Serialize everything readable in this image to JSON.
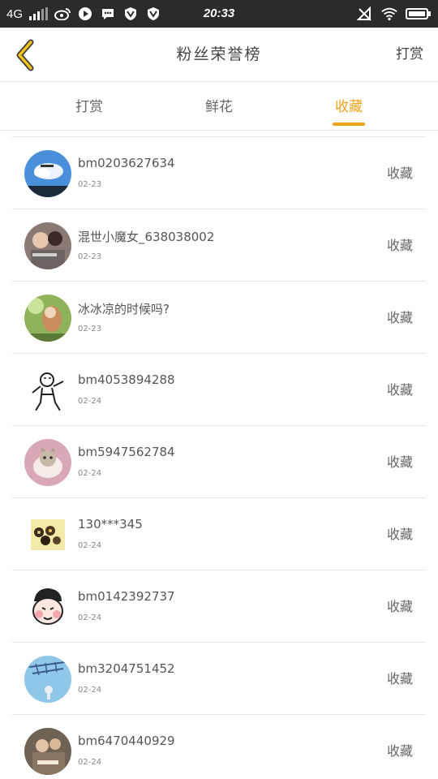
{
  "status_bar": {
    "network": "4G",
    "time": "20:33"
  },
  "header": {
    "title": "粉丝荣誉榜",
    "action_label": "打赏"
  },
  "tabs": [
    {
      "label": "打赏",
      "active": false
    },
    {
      "label": "鲜花",
      "active": false
    },
    {
      "label": "收藏",
      "active": true
    }
  ],
  "accent_color": "#f0a21b",
  "list": [
    {
      "name": "bm0203627634",
      "date": "02-23",
      "status": "收藏",
      "avatar": "sky-photo"
    },
    {
      "name": "混世小魔女_638038002",
      "date": "02-23",
      "status": "收藏",
      "avatar": "couple-photo"
    },
    {
      "name": "冰冰凉的时候吗?",
      "date": "02-23",
      "status": "收藏",
      "avatar": "girl-photo"
    },
    {
      "name": "bm4053894288",
      "date": "02-24",
      "status": "收藏",
      "avatar": "cartoon-tiger"
    },
    {
      "name": "bm5947562784",
      "date": "02-24",
      "status": "收藏",
      "avatar": "cat-photo"
    },
    {
      "name": "130***345",
      "date": "02-24",
      "status": "收藏",
      "avatar": "food-photo"
    },
    {
      "name": "bm0142392737",
      "date": "02-24",
      "status": "收藏",
      "avatar": "cartoon-face"
    },
    {
      "name": "bm3204751452",
      "date": "02-24",
      "status": "收藏",
      "avatar": "blue-photo"
    },
    {
      "name": "bm6470440929",
      "date": "02-24",
      "status": "收藏",
      "avatar": "people-photo"
    }
  ]
}
